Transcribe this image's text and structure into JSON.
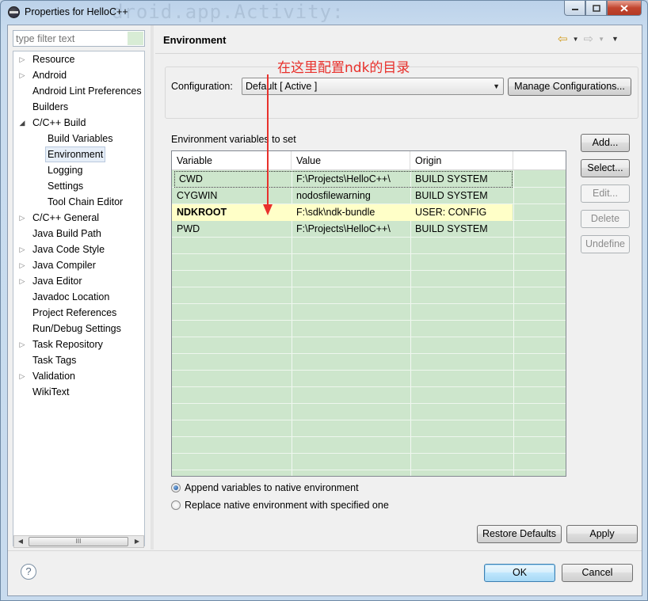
{
  "window": {
    "title": "Properties for HelloC++",
    "watermark_text": "droid.app.Activity:",
    "controls": {
      "minimize": "0",
      "maximize": "1",
      "close": "r"
    }
  },
  "filter": {
    "placeholder": "type filter text",
    "value": ""
  },
  "tree": {
    "items": [
      {
        "label": "Resource",
        "expander": "▷"
      },
      {
        "label": "Android",
        "expander": "▷"
      },
      {
        "label": "Android Lint Preferences",
        "expander": ""
      },
      {
        "label": "Builders",
        "expander": ""
      },
      {
        "label": "C/C++ Build",
        "expander": "◢"
      },
      {
        "label": "Build Variables",
        "expander": ""
      },
      {
        "label": "Environment",
        "expander": ""
      },
      {
        "label": "Logging",
        "expander": ""
      },
      {
        "label": "Settings",
        "expander": ""
      },
      {
        "label": "Tool Chain Editor",
        "expander": ""
      },
      {
        "label": "C/C++ General",
        "expander": "▷"
      },
      {
        "label": "Java Build Path",
        "expander": ""
      },
      {
        "label": "Java Code Style",
        "expander": "▷"
      },
      {
        "label": "Java Compiler",
        "expander": "▷"
      },
      {
        "label": "Java Editor",
        "expander": "▷"
      },
      {
        "label": "Javadoc Location",
        "expander": ""
      },
      {
        "label": "Project References",
        "expander": ""
      },
      {
        "label": "Run/Debug Settings",
        "expander": ""
      },
      {
        "label": "Task Repository",
        "expander": "▷"
      },
      {
        "label": "Task Tags",
        "expander": ""
      },
      {
        "label": "Validation",
        "expander": "▷"
      },
      {
        "label": "WikiText",
        "expander": ""
      }
    ],
    "selected": "Environment",
    "scroll_thumb_glyph": "III",
    "scroll_left": "◀",
    "scroll_right": "▶"
  },
  "page": {
    "title": "Environment",
    "nav": {
      "back": "⇦",
      "forward": "⇨",
      "dropdown": "▼",
      "menu": "▼"
    }
  },
  "annotation": {
    "text": "在这里配置ndk的目录",
    "color": "#e8312c"
  },
  "configuration": {
    "label": "Configuration:",
    "selected": "Default  [ Active ]",
    "manage_button": "Manage Configurations..."
  },
  "environment": {
    "label": "Environment variables to set",
    "columns": [
      "Variable",
      "Value",
      "Origin"
    ],
    "rows": [
      {
        "variable": "CWD",
        "value": "F:\\Projects\\HelloC++\\",
        "origin": "BUILD SYSTEM"
      },
      {
        "variable": "CYGWIN",
        "value": "nodosfilewarning",
        "origin": "BUILD SYSTEM"
      },
      {
        "variable": "NDKROOT",
        "value": "F:\\sdk\\ndk-bundle",
        "origin": "USER: CONFIG"
      },
      {
        "variable": "PWD",
        "value": "F:\\Projects\\HelloC++\\",
        "origin": "BUILD SYSTEM"
      }
    ],
    "row_bg": "#cde6cc",
    "user_row_bg": "#ffffc8"
  },
  "side_buttons": {
    "add": "Add...",
    "select": "Select...",
    "edit": "Edit...",
    "delete": "Delete",
    "undefine": "Undefine"
  },
  "options": {
    "append": "Append variables to native environment",
    "replace": "Replace native environment with specified one",
    "selected": "append"
  },
  "page_buttons": {
    "restore": "Restore Defaults",
    "apply": "Apply"
  },
  "dialog_buttons": {
    "help": "?",
    "ok": "OK",
    "cancel": "Cancel"
  }
}
